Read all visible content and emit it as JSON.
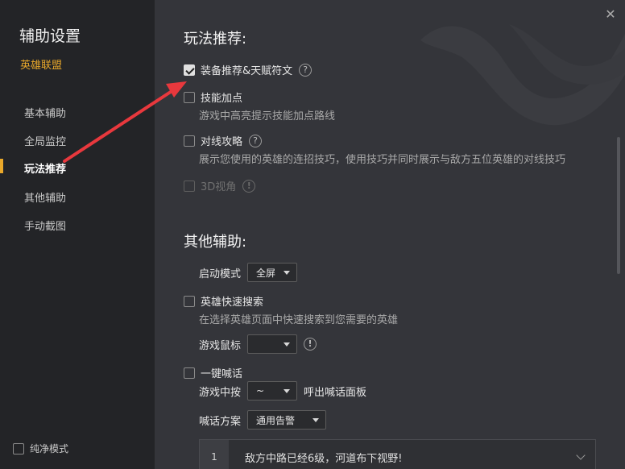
{
  "sidebar": {
    "title": "辅助设置",
    "game": "英雄联盟",
    "items": [
      {
        "label": "基本辅助"
      },
      {
        "label": "全局监控"
      },
      {
        "label": "玩法推荐"
      },
      {
        "label": "其他辅助"
      },
      {
        "label": "手动截图"
      }
    ],
    "active_index": 2,
    "clean_mode": "纯净模式"
  },
  "main": {
    "section1": {
      "title": "玩法推荐:",
      "items": [
        {
          "label": "装备推荐&天赋符文",
          "checked": true,
          "help": "?"
        },
        {
          "label": "技能加点",
          "checked": false,
          "desc": "游戏中高亮提示技能加点路线"
        },
        {
          "label": "对线攻略",
          "checked": false,
          "help": "?",
          "desc": "展示您使用的英雄的连招技巧，使用技巧并同时展示与敌方五位英雄的对线技巧"
        },
        {
          "label": "3D视角",
          "checked": false,
          "disabled": true,
          "help": "!"
        }
      ]
    },
    "section2": {
      "title": "其他辅助:",
      "launch_mode": {
        "label": "启动模式",
        "value": "全屏"
      },
      "hero_search": {
        "label": "英雄快速搜索",
        "desc": "在选择英雄页面中快速搜索到您需要的英雄"
      },
      "game_mouse": {
        "label": "游戏鼠标",
        "value": "",
        "help": "!"
      },
      "shout": {
        "label": "一键喊话"
      },
      "in_game_press": {
        "label": "游戏中按",
        "value": "~",
        "after": "呼出喊话面板"
      },
      "shout_plan": {
        "label": "喊话方案",
        "value": "通用告警"
      },
      "phrase": {
        "index": "1",
        "text": "敌方中路已经6级，河道布下视野!"
      }
    }
  },
  "colors": {
    "accent": "#e9a82a",
    "arrow": "#e8383d"
  }
}
